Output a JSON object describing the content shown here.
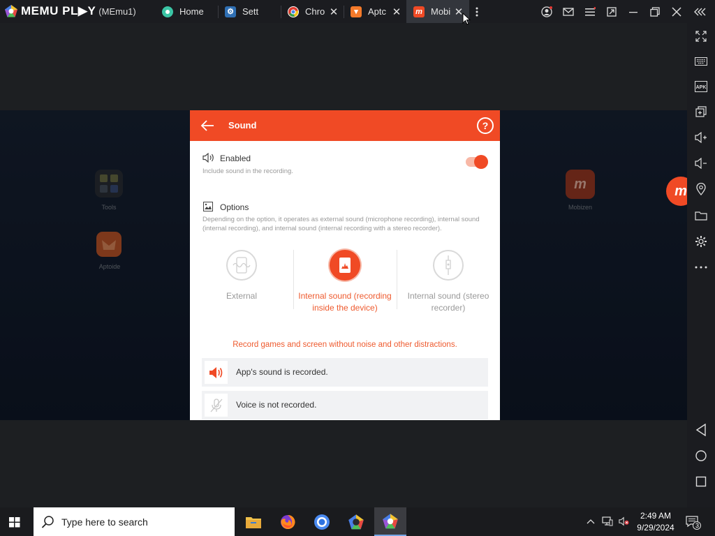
{
  "window": {
    "brand": "MEMU PL▶Y",
    "instance": "(MEmu1)",
    "tabs": [
      {
        "label": "Home"
      },
      {
        "label": "Sett"
      },
      {
        "label": "Chro"
      },
      {
        "label": "Aptc"
      },
      {
        "label": "Mobi"
      }
    ]
  },
  "desktop": {
    "icons": [
      {
        "label": "Tools"
      },
      {
        "label": "Aptoide"
      },
      {
        "label": "Mobizen"
      }
    ]
  },
  "dialog": {
    "title": "Sound",
    "help_label": "?",
    "enabled": {
      "title": "Enabled",
      "desc": "Include sound in the recording.",
      "on": true
    },
    "options": {
      "title": "Options",
      "desc": "Depending on the option, it operates as external sound (microphone recording), internal sound (internal recording), and internal sound (internal recording with a stereo recorder).",
      "items": [
        {
          "label": "External",
          "selected": false
        },
        {
          "label": "Internal sound (recording inside the device)",
          "selected": true
        },
        {
          "label": "Internal sound (stereo recorder)",
          "selected": false
        }
      ]
    },
    "tip": "Record games and screen without noise and other distractions.",
    "rows": [
      {
        "text": "App's sound is recorded."
      },
      {
        "text": "Voice is not recorded."
      }
    ]
  },
  "taskbar": {
    "search_placeholder": "Type here to search",
    "time": "2:49 AM",
    "date": "9/29/2024",
    "notification_count": "3"
  },
  "colors": {
    "accent": "#f04a25",
    "titlebar": "#1b1c20",
    "active_tab": "#33363c"
  }
}
